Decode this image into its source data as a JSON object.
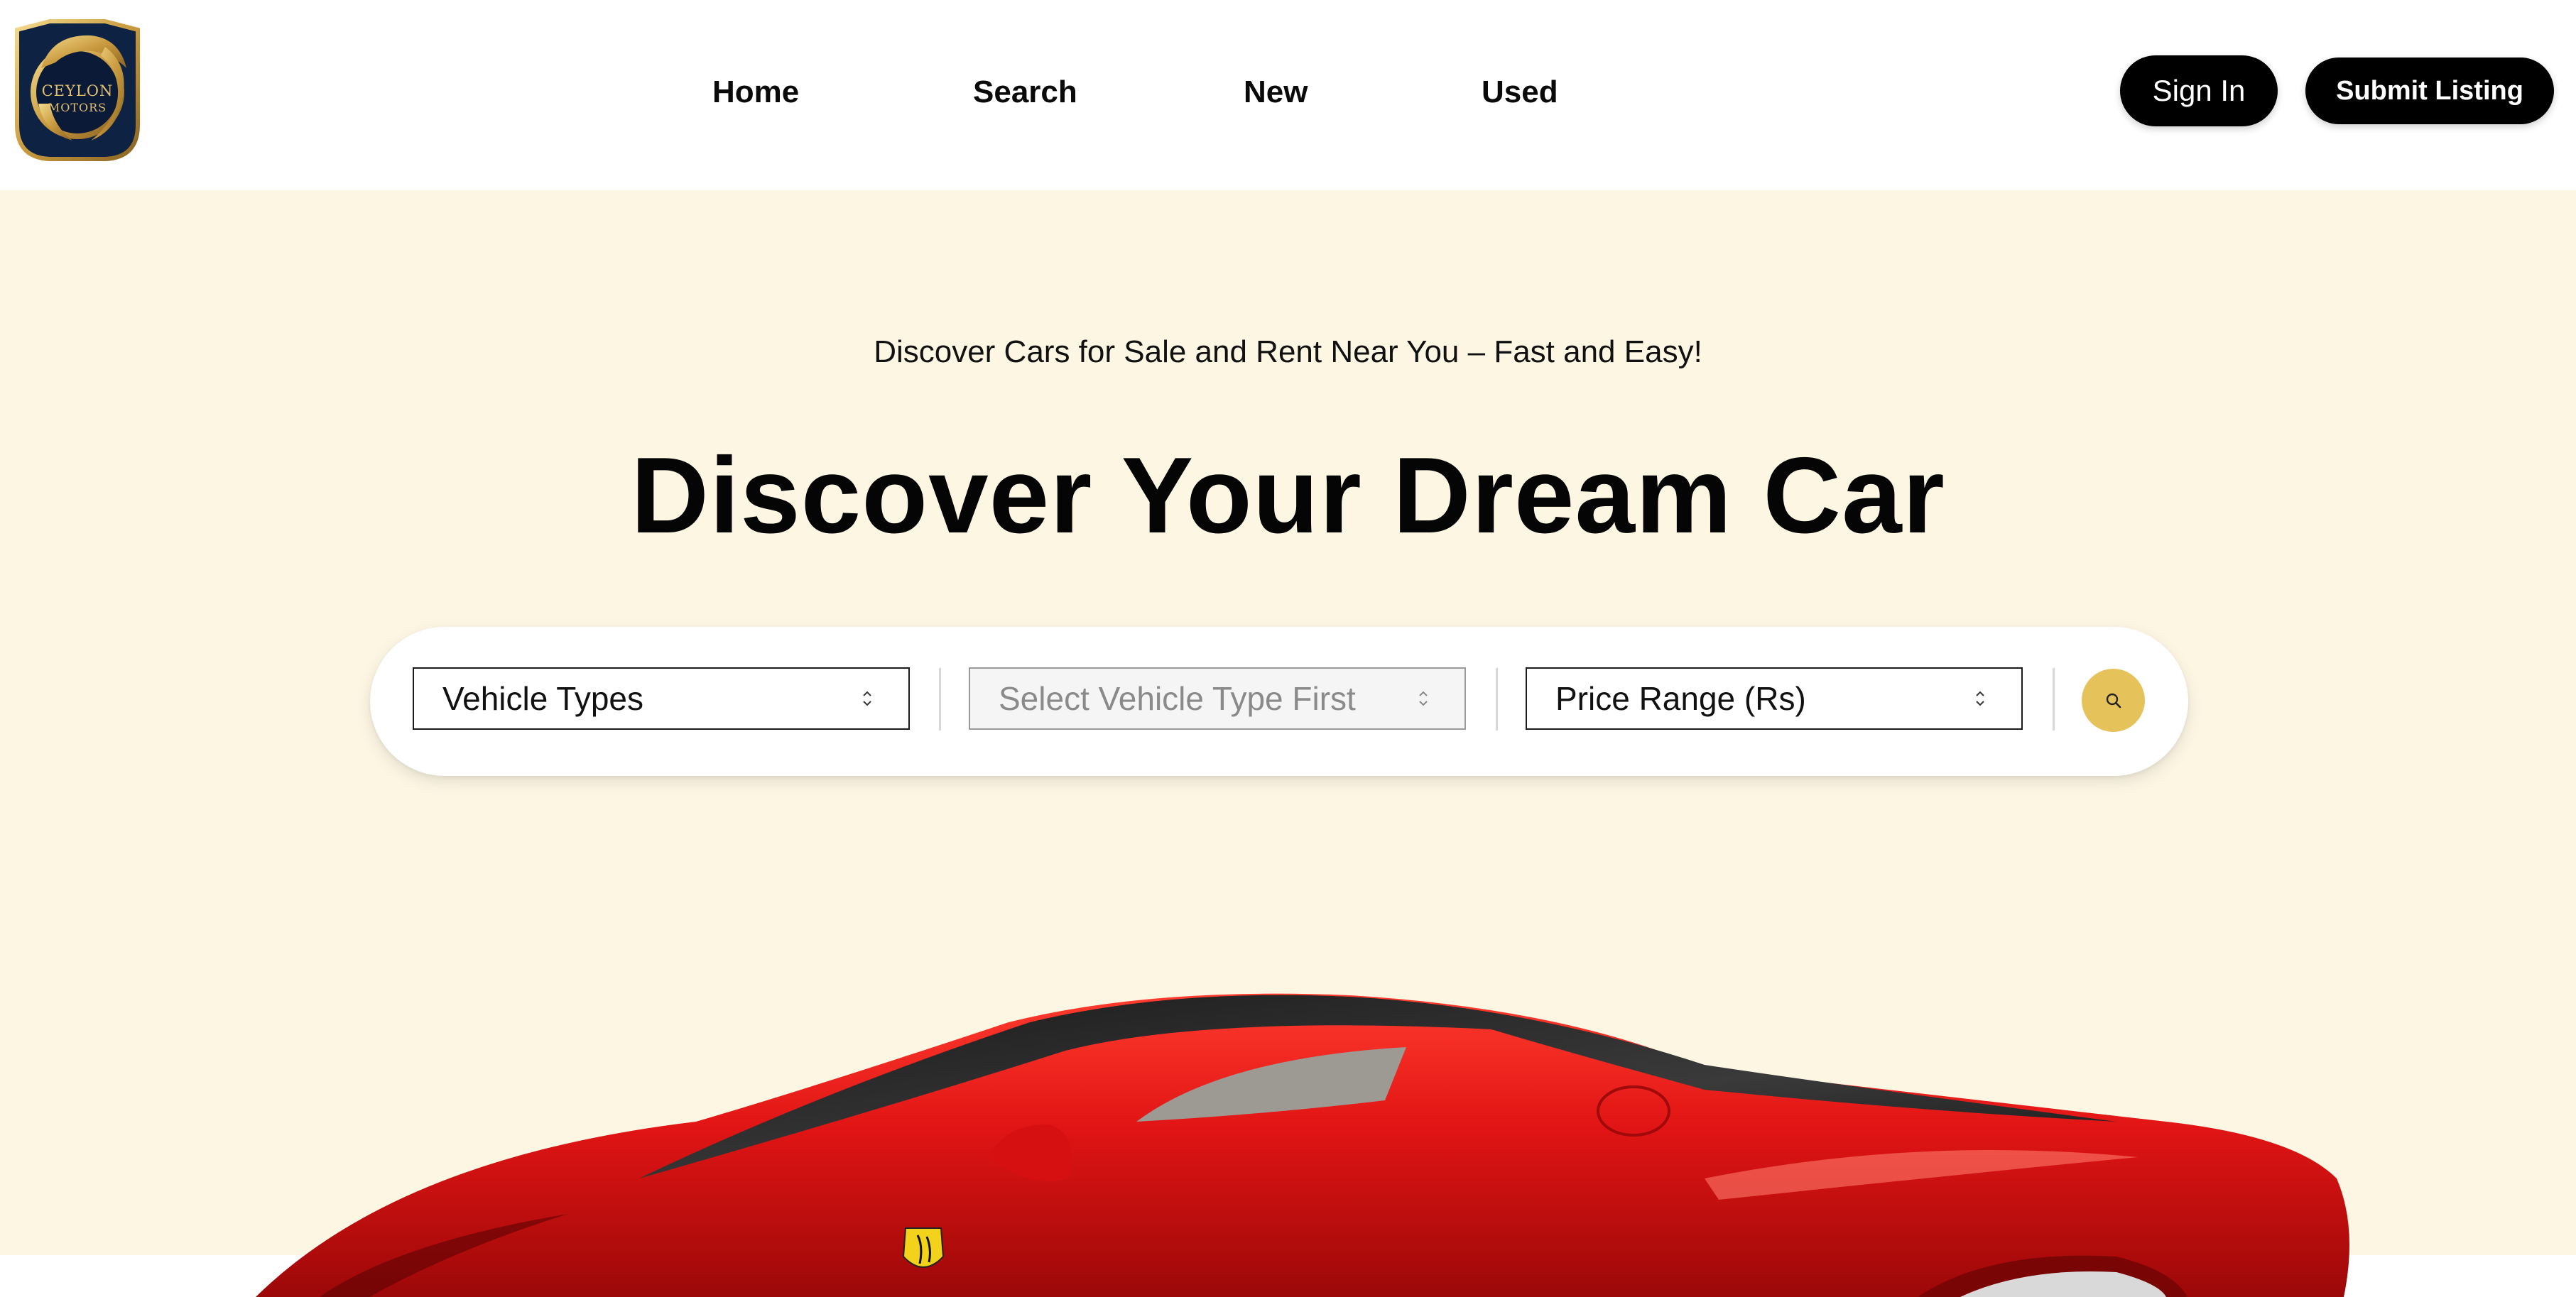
{
  "brand": {
    "logo_line1": "CEYLON",
    "logo_line2": "MOTORS",
    "icon": "lion-crest-logo"
  },
  "nav": {
    "home": "Home",
    "search": "Search",
    "new": "New",
    "used": "Used"
  },
  "actions": {
    "sign_in": "Sign In",
    "submit_listing": "Submit Listing"
  },
  "hero": {
    "subtitle": "Discover Cars for Sale and Rent Near You – Fast and Easy!",
    "title": "Discover Your Dream Car",
    "search": {
      "vehicle_types": "Vehicle Types",
      "vehicle_model": "Select Vehicle Type First",
      "price_range": "Price Range (Rs)",
      "button_icon": "search-icon"
    },
    "image": "red-sports-car"
  },
  "colors": {
    "hero_bg": "#fdf6e3",
    "accent": "#e6c35a",
    "button_dark": "#000000",
    "car_red": "#e11414"
  }
}
